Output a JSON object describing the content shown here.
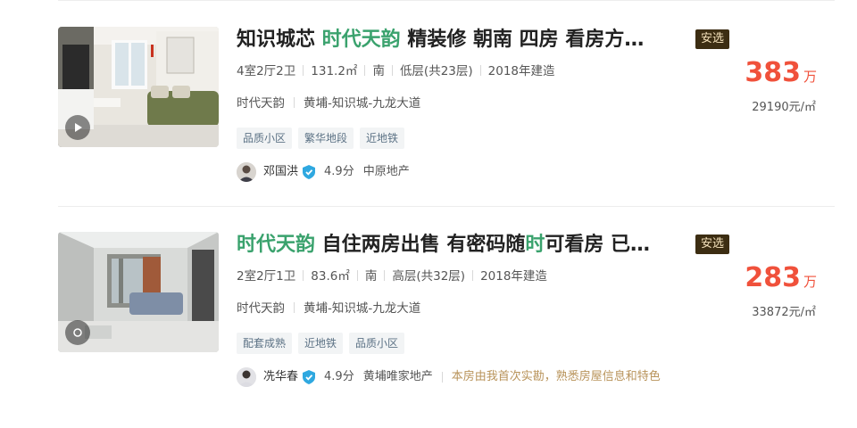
{
  "listings": [
    {
      "title_parts": [
        {
          "text": "知识城芯 ",
          "hl": false
        },
        {
          "text": "时代天韵",
          "hl": true
        },
        {
          "text": " 精装修 朝南 四房 看房方…",
          "hl": false
        }
      ],
      "badge": "安选",
      "info": [
        "4室2厅2卫",
        "131.2㎡",
        "南",
        "低层(共23层)",
        "2018年建造"
      ],
      "community": "时代天韵",
      "location": "黄埔-知识城-九龙大道",
      "tags": [
        "品质小区",
        "繁华地段",
        "近地铁"
      ],
      "agent": {
        "name": "邓国洪",
        "score": "4.9分",
        "company": "中原地产",
        "note": ""
      },
      "price": "383",
      "price_unit": "万",
      "unit_price": "29190元/㎡",
      "media_icon": "play-icon"
    },
    {
      "title_parts": [
        {
          "text": "时代天韵",
          "hl": true
        },
        {
          "text": " 自住两房出售 有密码随",
          "hl": false
        },
        {
          "text": "时",
          "hl": true
        },
        {
          "text": "可看房 已…",
          "hl": false
        }
      ],
      "badge": "安选",
      "info": [
        "2室2厅1卫",
        "83.6㎡",
        "南",
        "高层(共32层)",
        "2018年建造"
      ],
      "community": "时代天韵",
      "location": "黄埔-知识城-九龙大道",
      "tags": [
        "配套成熟",
        "近地铁",
        "品质小区"
      ],
      "agent": {
        "name": "冼华春",
        "score": "4.9分",
        "company": "黄埔唯家地产",
        "note": "本房由我首次实勘，熟悉房屋信息和特色"
      },
      "price": "283",
      "price_unit": "万",
      "unit_price": "33872元/㎡",
      "media_icon": "vr-icon"
    }
  ],
  "colors": {
    "highlight": "#3aa26d",
    "price": "#f0513b",
    "badge_bg": "#3c2d12",
    "badge_text": "#f4e1ba",
    "note": "#b8935a"
  }
}
